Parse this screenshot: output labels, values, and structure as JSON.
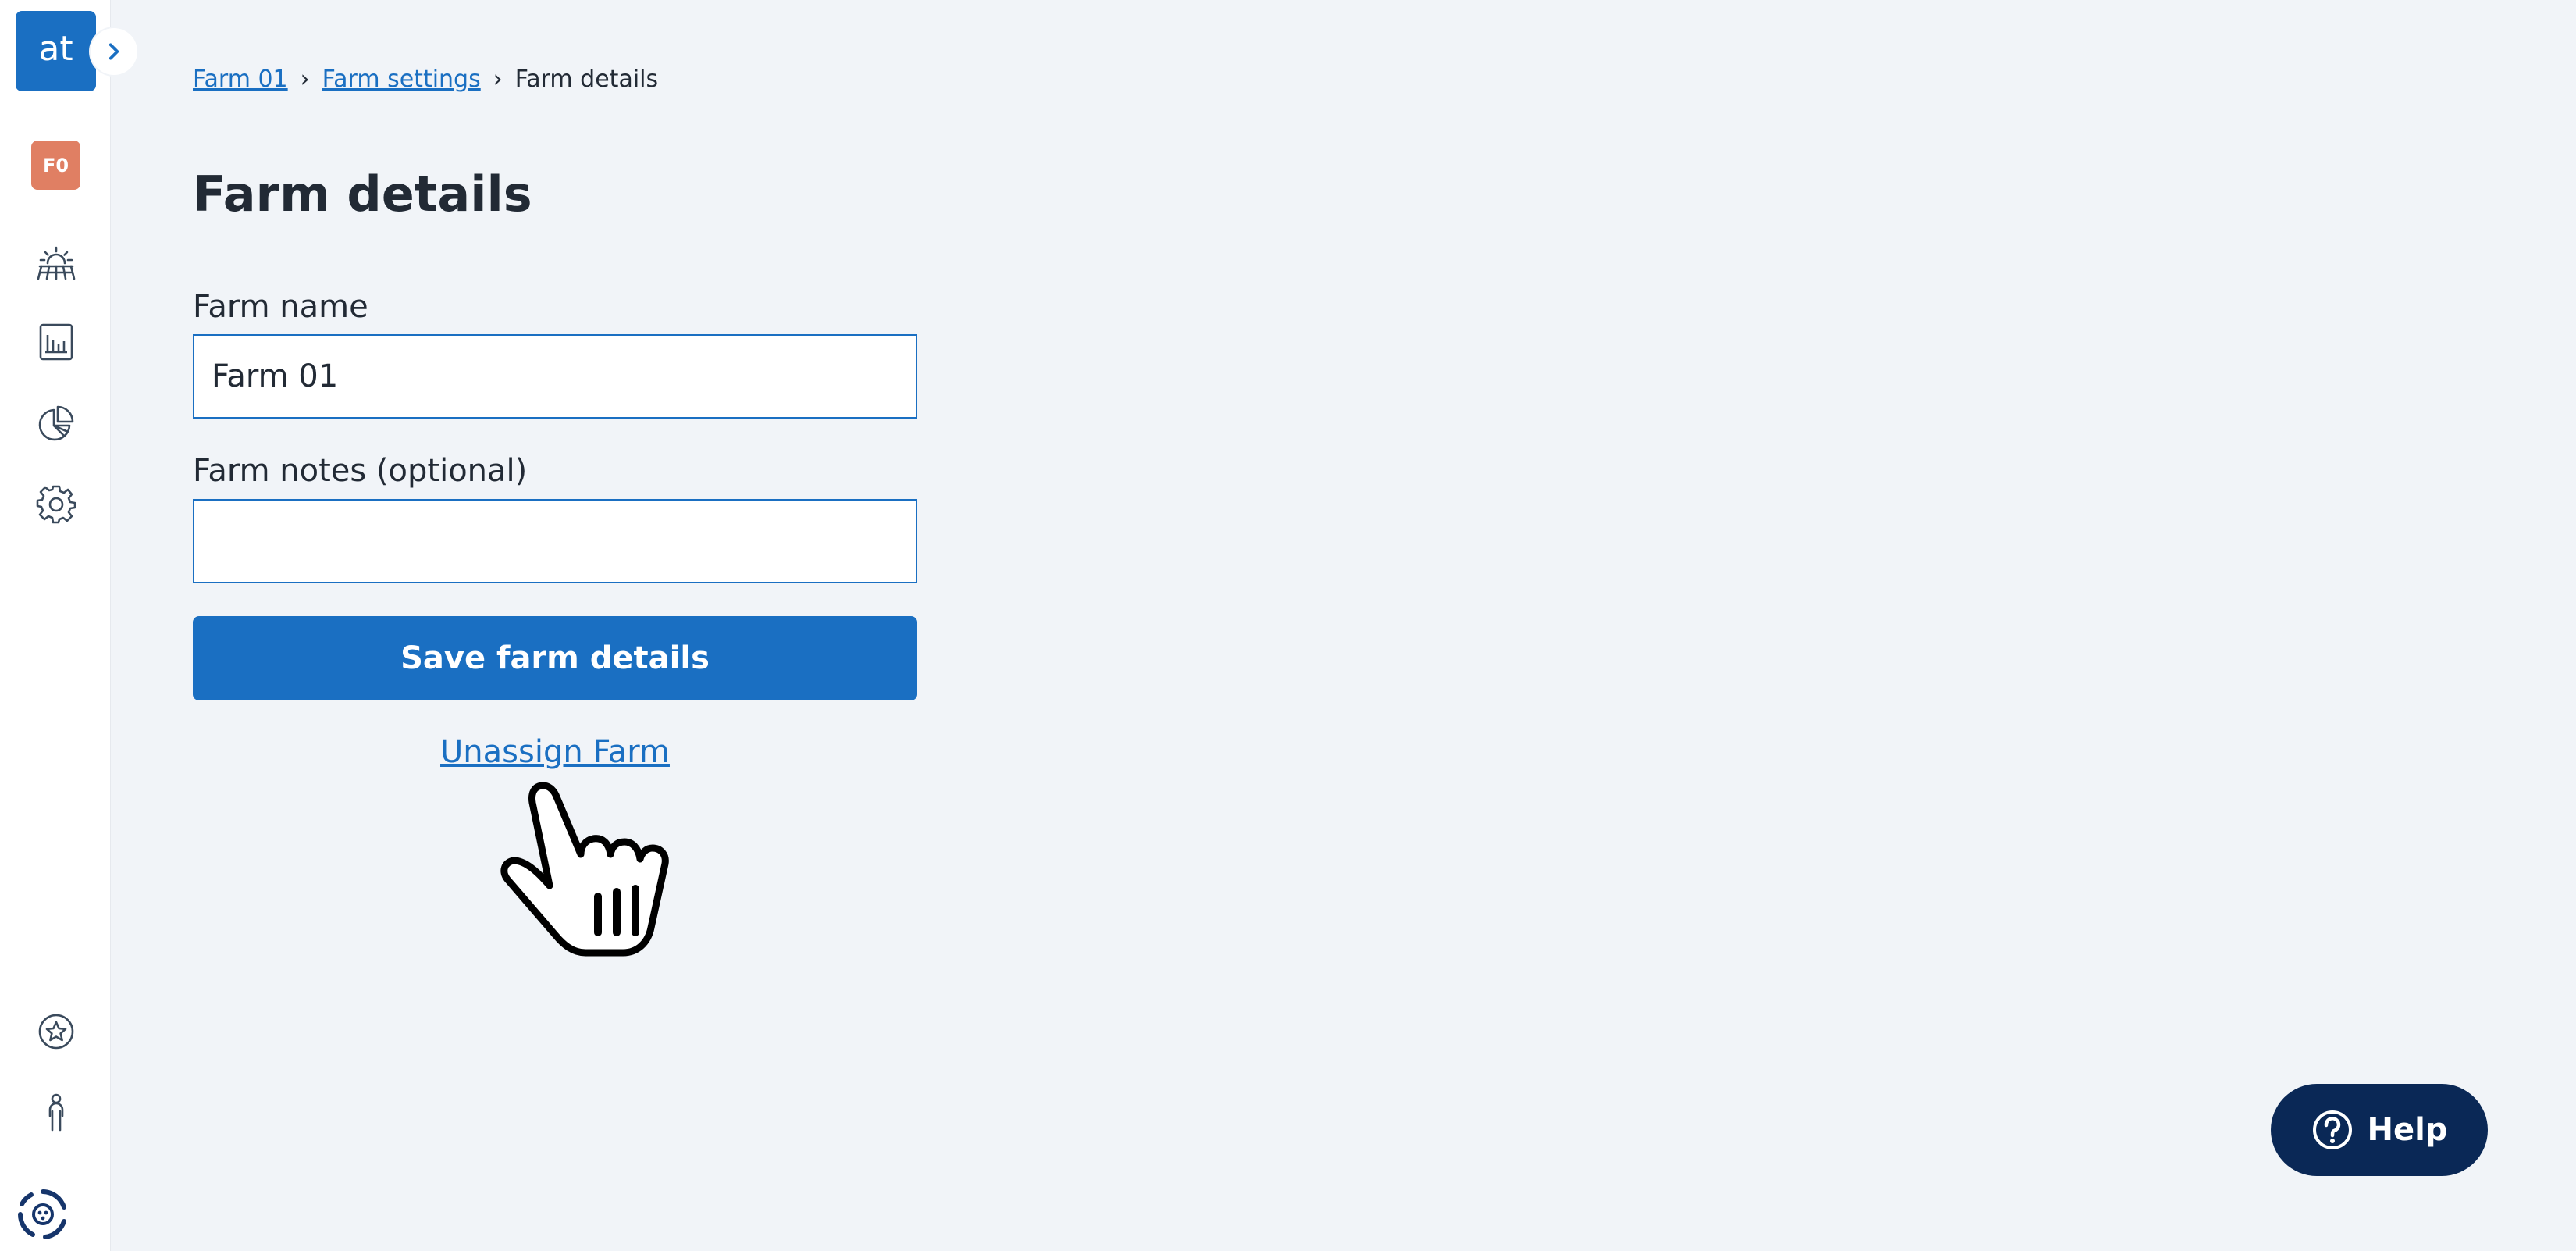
{
  "sidebar": {
    "logo_text": "at",
    "farm_badge": "F0",
    "icons": [
      "farm-sun-icon",
      "bar-chart-icon",
      "pie-chart-icon",
      "gear-icon",
      "star-icon",
      "person-icon",
      "app-logo-icon"
    ]
  },
  "breadcrumb": {
    "items": [
      "Farm 01",
      "Farm settings",
      "Farm details"
    ]
  },
  "page": {
    "title": "Farm details"
  },
  "form": {
    "farm_name_label": "Farm name",
    "farm_name_value": "Farm 01",
    "farm_notes_label": "Farm notes (optional)",
    "farm_notes_value": "",
    "save_label": "Save farm details",
    "unassign_label": "Unassign Farm"
  },
  "help": {
    "label": "Help"
  },
  "colors": {
    "primary": "#1a6fc2",
    "help_bg": "#0a2856",
    "badge": "#e07f63",
    "background": "#f1f4f8"
  }
}
